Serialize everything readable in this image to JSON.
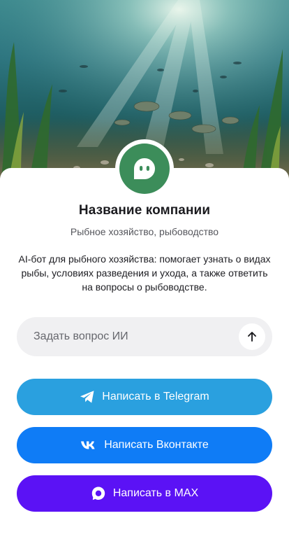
{
  "company": {
    "name": "Название компании",
    "category": "Рыбное хозяйство, рыбоводство",
    "description": "AI-бот для рыбного хозяйства: помогает узнать о видах рыбы, условиях разведения и ухода, а также ответить на вопросы о рыбоводстве."
  },
  "hero": {
    "image": "underwater-fish-scene"
  },
  "avatar": {
    "icon": "chat-bot-icon",
    "color": "#3c8d5a"
  },
  "ask": {
    "placeholder": "Задать вопрос ИИ",
    "send_icon": "arrow-up-icon"
  },
  "buttons": {
    "telegram": {
      "label": "Написать в Telegram",
      "icon": "telegram-icon",
      "color": "#2aa0df"
    },
    "vk": {
      "label": "Написать Вконтакте",
      "icon": "vk-icon",
      "color": "#0f7cf6"
    },
    "max": {
      "label": "Написать в MAX",
      "icon": "max-icon",
      "color": "#5b12f5"
    }
  }
}
